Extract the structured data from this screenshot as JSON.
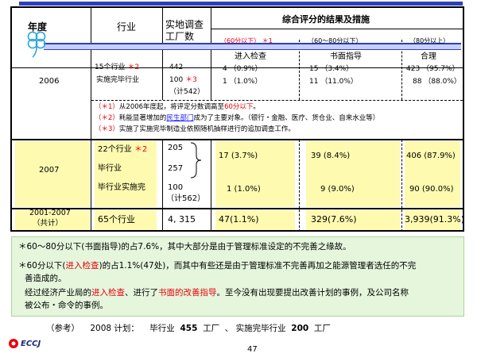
{
  "header": {
    "year": "年度",
    "industry": "行业",
    "survey_count": "实地调查\n工厂数",
    "results_title": "综合评分的结果及措施",
    "range_low": "（60分以下）",
    "range_low_mark": "＊1",
    "range_mid": "（60～80分以下）",
    "range_high": "（80分以上）",
    "action_low": "进入检查",
    "action_mid": "书面指导",
    "action_high": "合理"
  },
  "rows": {
    "y2006": {
      "year": "2006",
      "ind1": "15个行业",
      "ind1_mark": "＊2",
      "ind2": "实施完毕行业",
      "c1": "442",
      "c2": "100",
      "c2_mark": "＊3",
      "c3": "（计542）",
      "low1": "4 （0.9%）",
      "low2": "1 （1.0%）",
      "mid1": "15 （3.4%）",
      "mid2": "11 （11.0%）",
      "high1": "423 （95.7%）",
      "high2": "88 （88.0%）"
    },
    "notes": [
      {
        "mark": "（＊1）",
        "pre": "从2006年度起，将评定分数调高至",
        "hl": "60分以下",
        "post": "。"
      },
      {
        "mark": "（＊2）",
        "pre": "耗能显著增加的",
        "hl": "民生部门",
        "post": "成为了主要对象。（银行・金融、医疗、货仓业、自来水业等）"
      },
      {
        "mark": "（＊3）",
        "pre": "实施了实施完毕制造业依照随机抽样进行的追加调查工作。",
        "hl": "",
        "post": ""
      }
    ],
    "y2007": {
      "year": "2007",
      "ind1": "22个行业",
      "ind1_mark": "＊2",
      "ind2": "毕行业",
      "ind3": "毕行业实施完",
      "c1": "205",
      "c2": "257",
      "c3": "100",
      "c4": "（计562）",
      "low1": "17 (3.7%)",
      "low2": "1 (1.0%)",
      "mid1": "39 (8.4%)",
      "mid2": "9   (9.0%)",
      "high1": "406 (87.9%)",
      "high2": "90 (90.0%)"
    },
    "total": {
      "year1": "2001-2007",
      "year2": "（共计）",
      "ind": "65个行业",
      "count": "4, 315",
      "low": "47(1.1%)",
      "mid": "329(7.6%)",
      "high": "3,939(91.3%)"
    }
  },
  "bullets": {
    "b1": "＊60～80分以下(书面指导)的占7.6%，其中大部分是由于管理标准设定的不完善之缘故。",
    "b2_pre": "＊60分以下(",
    "b2_hl": "进入检查",
    "b2_post1": ")的占1.1%(47处)，而其中有些还是由于管理标准不完善再加之能源管理者选任的不完",
    "b2_post2": "善造成的。",
    "b3_pre": "经过经济产业局的",
    "b3_hl1": "进入检查",
    "b3_mid": "、进行了",
    "b3_hl2": "书面的改善指导",
    "b3_post1": "。至今没有出现要提出改善计划的事例，及公司名称",
    "b3_post2": "被公布・命令的事例。"
  },
  "reference": {
    "label": "（参考）",
    "plan": "2008 计划：",
    "ind1": "毕行业",
    "n1": "455",
    "unit1": "工厂",
    "sep": "、",
    "ind2": "实施完毕行业",
    "n2": "200",
    "unit2": "工厂"
  },
  "footer": {
    "logo": "ECCJ",
    "page": "47"
  }
}
